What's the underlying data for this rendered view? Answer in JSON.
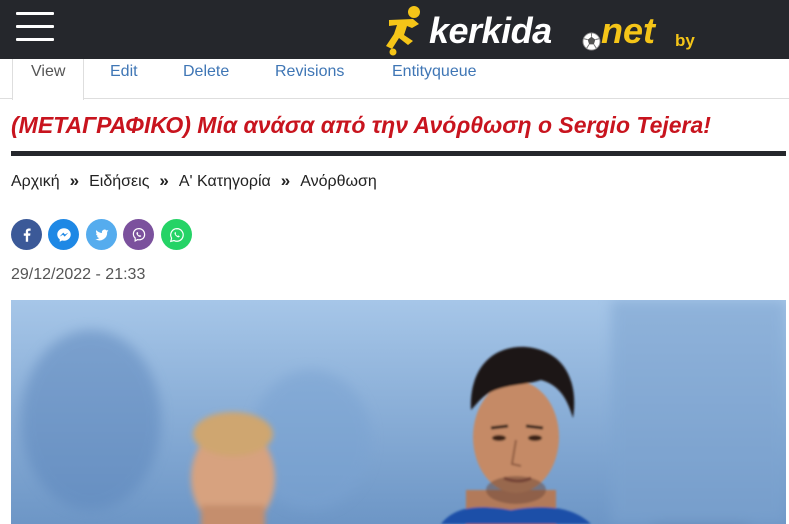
{
  "header": {
    "menu_icon": "hamburger-menu-icon",
    "logo": {
      "part1": "kerkida",
      "part2": "net",
      "suffix": "by",
      "colors": {
        "background": "#25272c",
        "accent": "#f5c518",
        "text": "#ffffff"
      }
    }
  },
  "tabs": [
    {
      "label": "View",
      "active": true
    },
    {
      "label": "Edit",
      "active": false
    },
    {
      "label": "Delete",
      "active": false
    },
    {
      "label": "Revisions",
      "active": false
    },
    {
      "label": "Entityqueue",
      "active": false
    }
  ],
  "article": {
    "title": "(ΜΕΤΑΓΡΑΦΙΚΟ) Μία ανάσα από την Ανόρθωση ο Sergio Tejera!",
    "title_color": "#c8141e",
    "breadcrumb": [
      "Αρχική",
      "Ειδήσεις",
      "Α' Κατηγορία",
      "Ανόρθωση"
    ],
    "breadcrumb_separator": "»",
    "date": "29/12/2022 - 21:33",
    "share": [
      {
        "name": "facebook-icon",
        "color": "#3b5998"
      },
      {
        "name": "messenger-icon",
        "color": "#1e88e5"
      },
      {
        "name": "twitter-icon",
        "color": "#55acee"
      },
      {
        "name": "viber-icon",
        "color": "#7b519d"
      },
      {
        "name": "whatsapp-icon",
        "color": "#25d366"
      }
    ]
  }
}
